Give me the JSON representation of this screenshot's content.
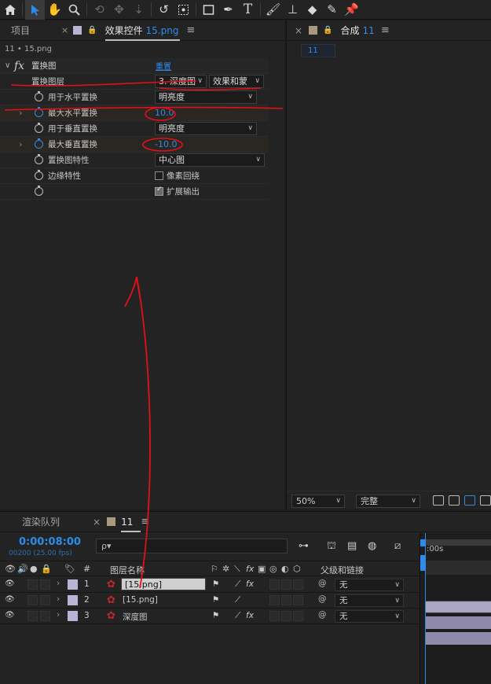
{
  "toolbar": {
    "tools": [
      "home-icon",
      "selection-arrow-icon",
      "hand-icon",
      "zoom-icon",
      "camera-orbit-icon",
      "pan-behind-icon",
      "move-down-icon",
      "rotate-icon",
      "region-icon",
      "rectangle-icon",
      "pen-icon",
      "text-icon",
      "brush-icon",
      "clone-stamp-icon",
      "eraser-icon",
      "roto-brush-icon",
      "puppet-pin-icon"
    ]
  },
  "effects_panel": {
    "project_tab": "项目",
    "effects_tab_label": "效果控件",
    "effects_tab_file": "15.png",
    "breadcrumb": "11 • 15.png",
    "effect_name": "置换图",
    "reset_label": "重置",
    "rows": {
      "layer_label": "置换图层",
      "layer_value": "3. 深度图",
      "layer_mode": "效果和蒙",
      "horiz_use_label": "用于水平置换",
      "horiz_use_value": "明亮度",
      "max_horiz_label": "最大水平置换",
      "max_horiz_value": "10.0",
      "vert_use_label": "用于垂直置换",
      "vert_use_value": "明亮度",
      "max_vert_label": "最大垂直置换",
      "max_vert_value": "-10.0",
      "map_behavior_label": "置换图特性",
      "map_behavior_value": "中心图",
      "edge_label": "边缘特性",
      "wrap_label": "像素回绕",
      "wrap_checked": false,
      "expand_label": "扩展输出",
      "expand_checked": true
    }
  },
  "comp_panel": {
    "tab_label": "合成",
    "tab_num": "11",
    "chip": "11",
    "zoom": "50%",
    "quality": "完整"
  },
  "timeline": {
    "render_queue_tab": "渲染队列",
    "comp_tab": "11",
    "timecode": "0:00:08:00",
    "fps": "00200 (25.00 fps)",
    "search_placeholder": "ρ▾",
    "col_number": "#",
    "col_layer_name": "图层名称",
    "col_parent": "父级和链接",
    "ruler_tick": ":00s",
    "layers": [
      {
        "num": "1",
        "name": "[15.png]",
        "parent": "无",
        "selected": true
      },
      {
        "num": "2",
        "name": "[15.png]",
        "parent": "无",
        "selected": false
      },
      {
        "num": "3",
        "name": "深度图",
        "parent": "无",
        "selected": false
      }
    ]
  },
  "colors": {
    "accent_blue": "#2d8ceb",
    "annotation_red": "#e1101a",
    "label_lavender": "#b9b3d6"
  }
}
